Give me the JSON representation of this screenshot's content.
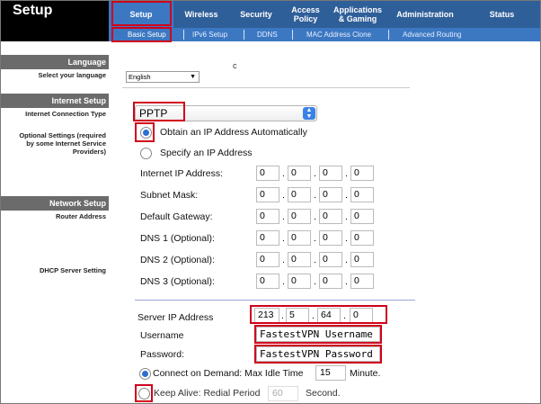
{
  "header": {
    "title": "Setup"
  },
  "top_nav": [
    {
      "label": "Setup",
      "active": true
    },
    {
      "label": "Wireless"
    },
    {
      "label": "Security"
    },
    {
      "label": "Access Policy"
    },
    {
      "label": "Applications & Gaming"
    },
    {
      "label": "Administration"
    },
    {
      "label": "Status"
    }
  ],
  "sub_nav": [
    {
      "label": "Basic Setup",
      "active": true
    },
    {
      "label": "IPv6 Setup"
    },
    {
      "label": "DDNS"
    },
    {
      "label": "MAC Address Clone"
    },
    {
      "label": "Advanced Routing"
    }
  ],
  "sections": {
    "language": {
      "heading": "Language",
      "label": "Select your language",
      "value": "English"
    },
    "internet_setup": {
      "heading": "Internet Setup",
      "connection_type_label": "Internet Connection Type",
      "connection_type": "PPTP",
      "optional_label": "Optional Settings (required by some Internet Service Providers)"
    },
    "network_setup": {
      "heading": "Network Setup",
      "router_address_label": "Router Address",
      "dhcp_label": "DHCP Server Setting"
    }
  },
  "ip_mode": {
    "obtain_label": "Obtain an IP Address Automatically",
    "specify_label": "Specify an IP Address",
    "selected": "obtain"
  },
  "static_fields": [
    {
      "label": "Internet IP Address:",
      "octets": [
        "0",
        "0",
        "0",
        "0"
      ]
    },
    {
      "label": "Subnet Mask:",
      "octets": [
        "0",
        "0",
        "0",
        "0"
      ]
    },
    {
      "label": "Default Gateway:",
      "octets": [
        "0",
        "0",
        "0",
        "0"
      ]
    },
    {
      "label": "DNS 1 (Optional):",
      "octets": [
        "0",
        "0",
        "0",
        "0"
      ]
    },
    {
      "label": "DNS 2 (Optional):",
      "octets": [
        "0",
        "0",
        "0",
        "0"
      ]
    },
    {
      "label": "DNS 3 (Optional):",
      "octets": [
        "0",
        "0",
        "0",
        "0"
      ]
    }
  ],
  "server": {
    "label": "Server IP Address",
    "octets": [
      "213",
      "5",
      "64",
      "0"
    ],
    "username_label": "Username",
    "username": "FastestVPN Username",
    "password_label": "Password:",
    "password": "FastestVPN Password"
  },
  "connect_on_demand": {
    "label": "Connect on Demand: Max Idle Time",
    "value": "15",
    "unit": "Minute."
  },
  "keep_alive": {
    "label": "Keep Alive: Redial Period",
    "value": "60",
    "unit": "Second."
  },
  "misc": {
    "mark": "c"
  },
  "colors": {
    "nav": "#2f5f99",
    "nav_active": "#3c78c2",
    "highlight": "#d0021b",
    "section_bar": "#6b6b6b"
  }
}
